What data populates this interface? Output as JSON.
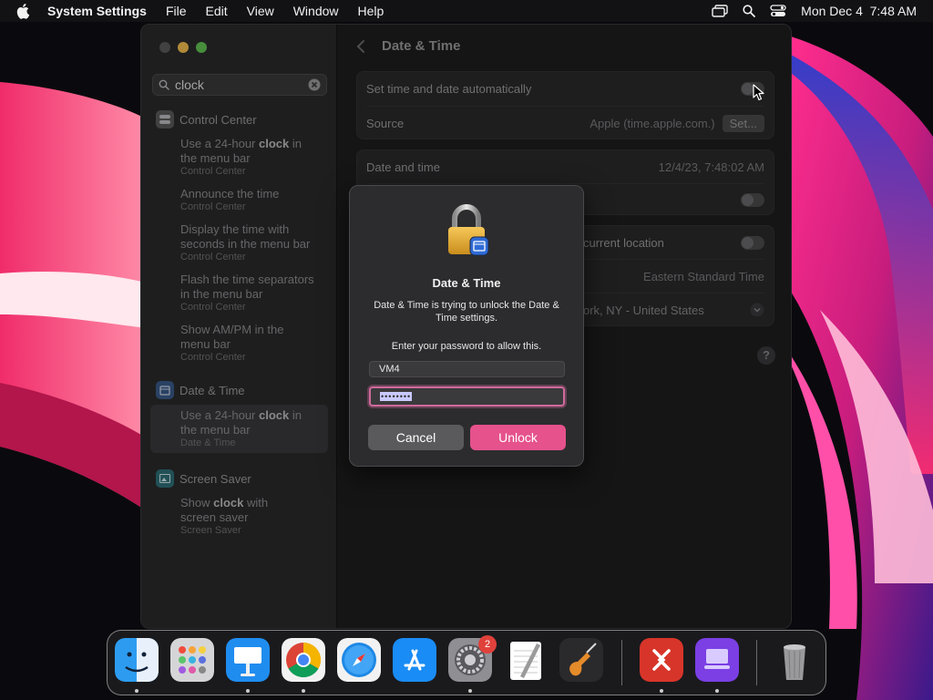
{
  "menubar": {
    "app_name": "System Settings",
    "menus": [
      "File",
      "Edit",
      "View",
      "Window",
      "Help"
    ],
    "datetime": "Mon Dec 4  7:48 AM"
  },
  "sidebar": {
    "search_value": "clock",
    "groups": [
      {
        "title": "Control Center",
        "results": [
          {
            "pre": "Use a 24-hour ",
            "bold": "clock",
            "post": " in the menu bar",
            "sub": "Control Center"
          },
          {
            "pre": "Announce the time",
            "bold": "",
            "post": "",
            "sub": "Control Center"
          },
          {
            "pre": "Display the time with seconds in the menu bar",
            "bold": "",
            "post": "",
            "sub": "Control Center"
          },
          {
            "pre": "Flash the time separators in the menu bar",
            "bold": "",
            "post": "",
            "sub": "Control Center"
          },
          {
            "pre": "Show AM/PM in the menu bar",
            "bold": "",
            "post": "",
            "sub": "Control Center"
          }
        ]
      },
      {
        "title": "Date & Time",
        "results": [
          {
            "pre": "Use a 24-hour ",
            "bold": "clock",
            "post": " in the menu bar",
            "sub": "Date & Time"
          }
        ]
      },
      {
        "title": "Screen Saver",
        "results": [
          {
            "pre": "Show ",
            "bold": "clock",
            "post": " with screen saver",
            "sub": "Screen Saver"
          }
        ]
      }
    ]
  },
  "main": {
    "title": "Date & Time",
    "set_auto_label": "Set time and date automatically",
    "source_label": "Source",
    "source_value": "Apple (time.apple.com.)",
    "set_button": "Set...",
    "date_time_label": "Date and time",
    "date_time_value": "12/4/23, 7:48:02 AM",
    "location_label": "current location",
    "timezone_value": "Eastern Standard Time",
    "city_value": "ork, NY - United States",
    "help": "?"
  },
  "dialog": {
    "title": "Date & Time",
    "message": "Date & Time is trying to unlock the Date & Time settings.",
    "prompt": "Enter your password to allow this.",
    "username": "VM4",
    "password_mask": "••••••••",
    "cancel": "Cancel",
    "unlock": "Unlock"
  },
  "dock": {
    "badge": "2",
    "apps": [
      "finder",
      "launchpad",
      "keynote",
      "chrome",
      "safari",
      "app-store",
      "system-settings",
      "textedit",
      "garageband",
      "remote-desktop",
      "apple-configurator",
      "trash"
    ]
  },
  "colors": {
    "accent": "#e5528c",
    "focus_ring": "#d06a9c"
  }
}
